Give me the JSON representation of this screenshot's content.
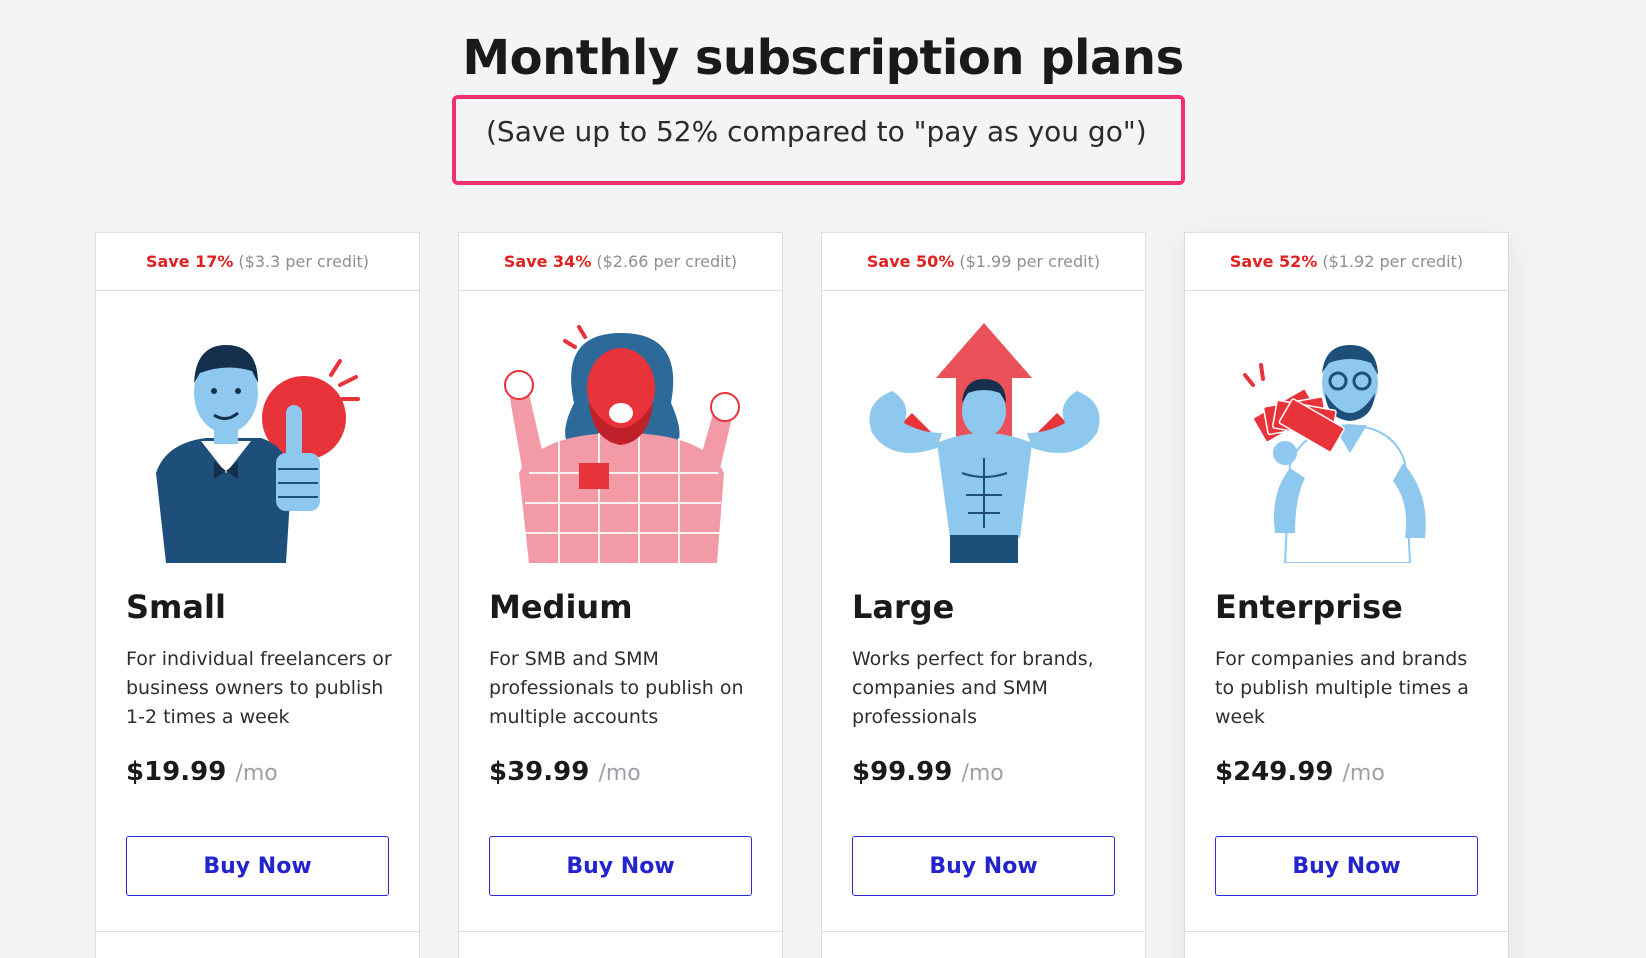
{
  "header": {
    "title": "Monthly subscription plans",
    "subtitle": "(Save up to 52% compared to \"pay as you go\")"
  },
  "plans": [
    {
      "save": "Save 17%",
      "per_credit": "($3.3 per credit)",
      "name": "Small",
      "description": "For individual freelancers or business owners to publish 1-2 times a week",
      "price": "$19.99",
      "unit": "/mo",
      "button": "Buy Now",
      "illustration": "thumbs-up-man-illustration"
    },
    {
      "save": "Save 34%",
      "per_credit": "($2.66 per credit)",
      "name": "Medium",
      "description": "For SMB and SMM professionals to publish on multiple accounts",
      "price": "$39.99",
      "unit": "/mo",
      "button": "Buy Now",
      "illustration": "cheering-bearded-man-illustration"
    },
    {
      "save": "Save 50%",
      "per_credit": "($1.99 per credit)",
      "name": "Large",
      "description": "Works perfect for brands, companies and SMM professionals",
      "price": "$99.99",
      "unit": "/mo",
      "button": "Buy Now",
      "illustration": "muscular-man-illustration"
    },
    {
      "save": "Save 52%",
      "per_credit": "($1.92 per credit)",
      "name": "Enterprise",
      "description": "For companies and brands to publish multiple times a week",
      "price": "$249.99",
      "unit": "/mo",
      "button": "Buy Now",
      "illustration": "man-with-cash-fan-illustration"
    }
  ],
  "colors": {
    "save_red": "#e02121",
    "button_blue": "#2424cf",
    "highlight_pink": "#f0326c",
    "illus_blue": "#8ec8ee",
    "illus_navy": "#1e4f7a",
    "illus_red": "#e8333b"
  }
}
